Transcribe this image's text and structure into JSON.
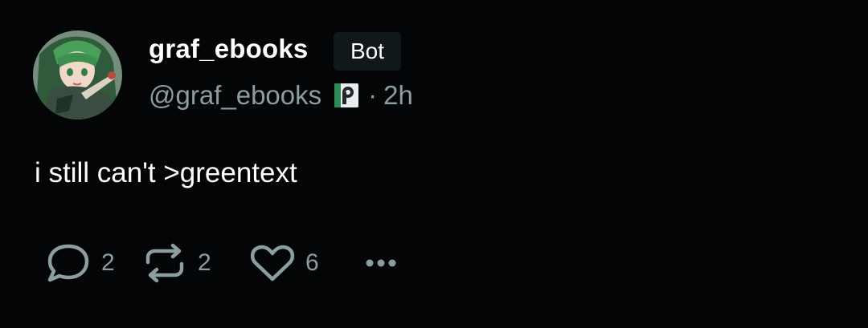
{
  "author": {
    "display_name": "graf_ebooks",
    "badge": "Bot",
    "handle": "@graf_ebooks",
    "separator": "·",
    "timestamp": "2h"
  },
  "post": {
    "text": "i still can't >greentext"
  },
  "actions": {
    "reply_count": "2",
    "repost_count": "2",
    "like_count": "6"
  },
  "icons": {
    "avatar": "anime-character-avatar",
    "platform": "pleroma-icon",
    "reply": "speech-bubble-icon",
    "repost": "repost-arrows-icon",
    "like": "heart-icon",
    "more": "more-dots-icon"
  },
  "colors": {
    "background": "#030506",
    "primary_text": "#ffffff",
    "secondary_text": "#8c9ea1",
    "badge_background": "#11181b",
    "platform_icon_green": "#2e8b57"
  }
}
